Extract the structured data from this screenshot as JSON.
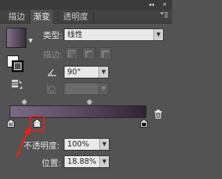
{
  "header": {
    "collapse_glyph": "◂◂",
    "close_glyph": "✕"
  },
  "tabs": [
    {
      "label": "描边",
      "active": false
    },
    {
      "label": "渐变",
      "active": true
    },
    {
      "label": "透明度",
      "active": false
    }
  ],
  "panel": {
    "type_label": "类型:",
    "type_value": "线性",
    "stroke_label": "描边:",
    "angle_value": "90°",
    "aspect_value": "",
    "opacity_label": "不透明度:",
    "opacity_value": "100%",
    "location_label": "位置:",
    "location_value": "18.88%"
  },
  "colors": {
    "highlight": "#e0231b",
    "gradient_start": "#7a6a86",
    "gradient_end": "#2e2530"
  },
  "icons": [
    "panel-menu-icon",
    "angle-icon",
    "aspect-ratio-icon",
    "reverse-gradient-icon",
    "trash-icon",
    "gradient-stop-icon"
  ]
}
